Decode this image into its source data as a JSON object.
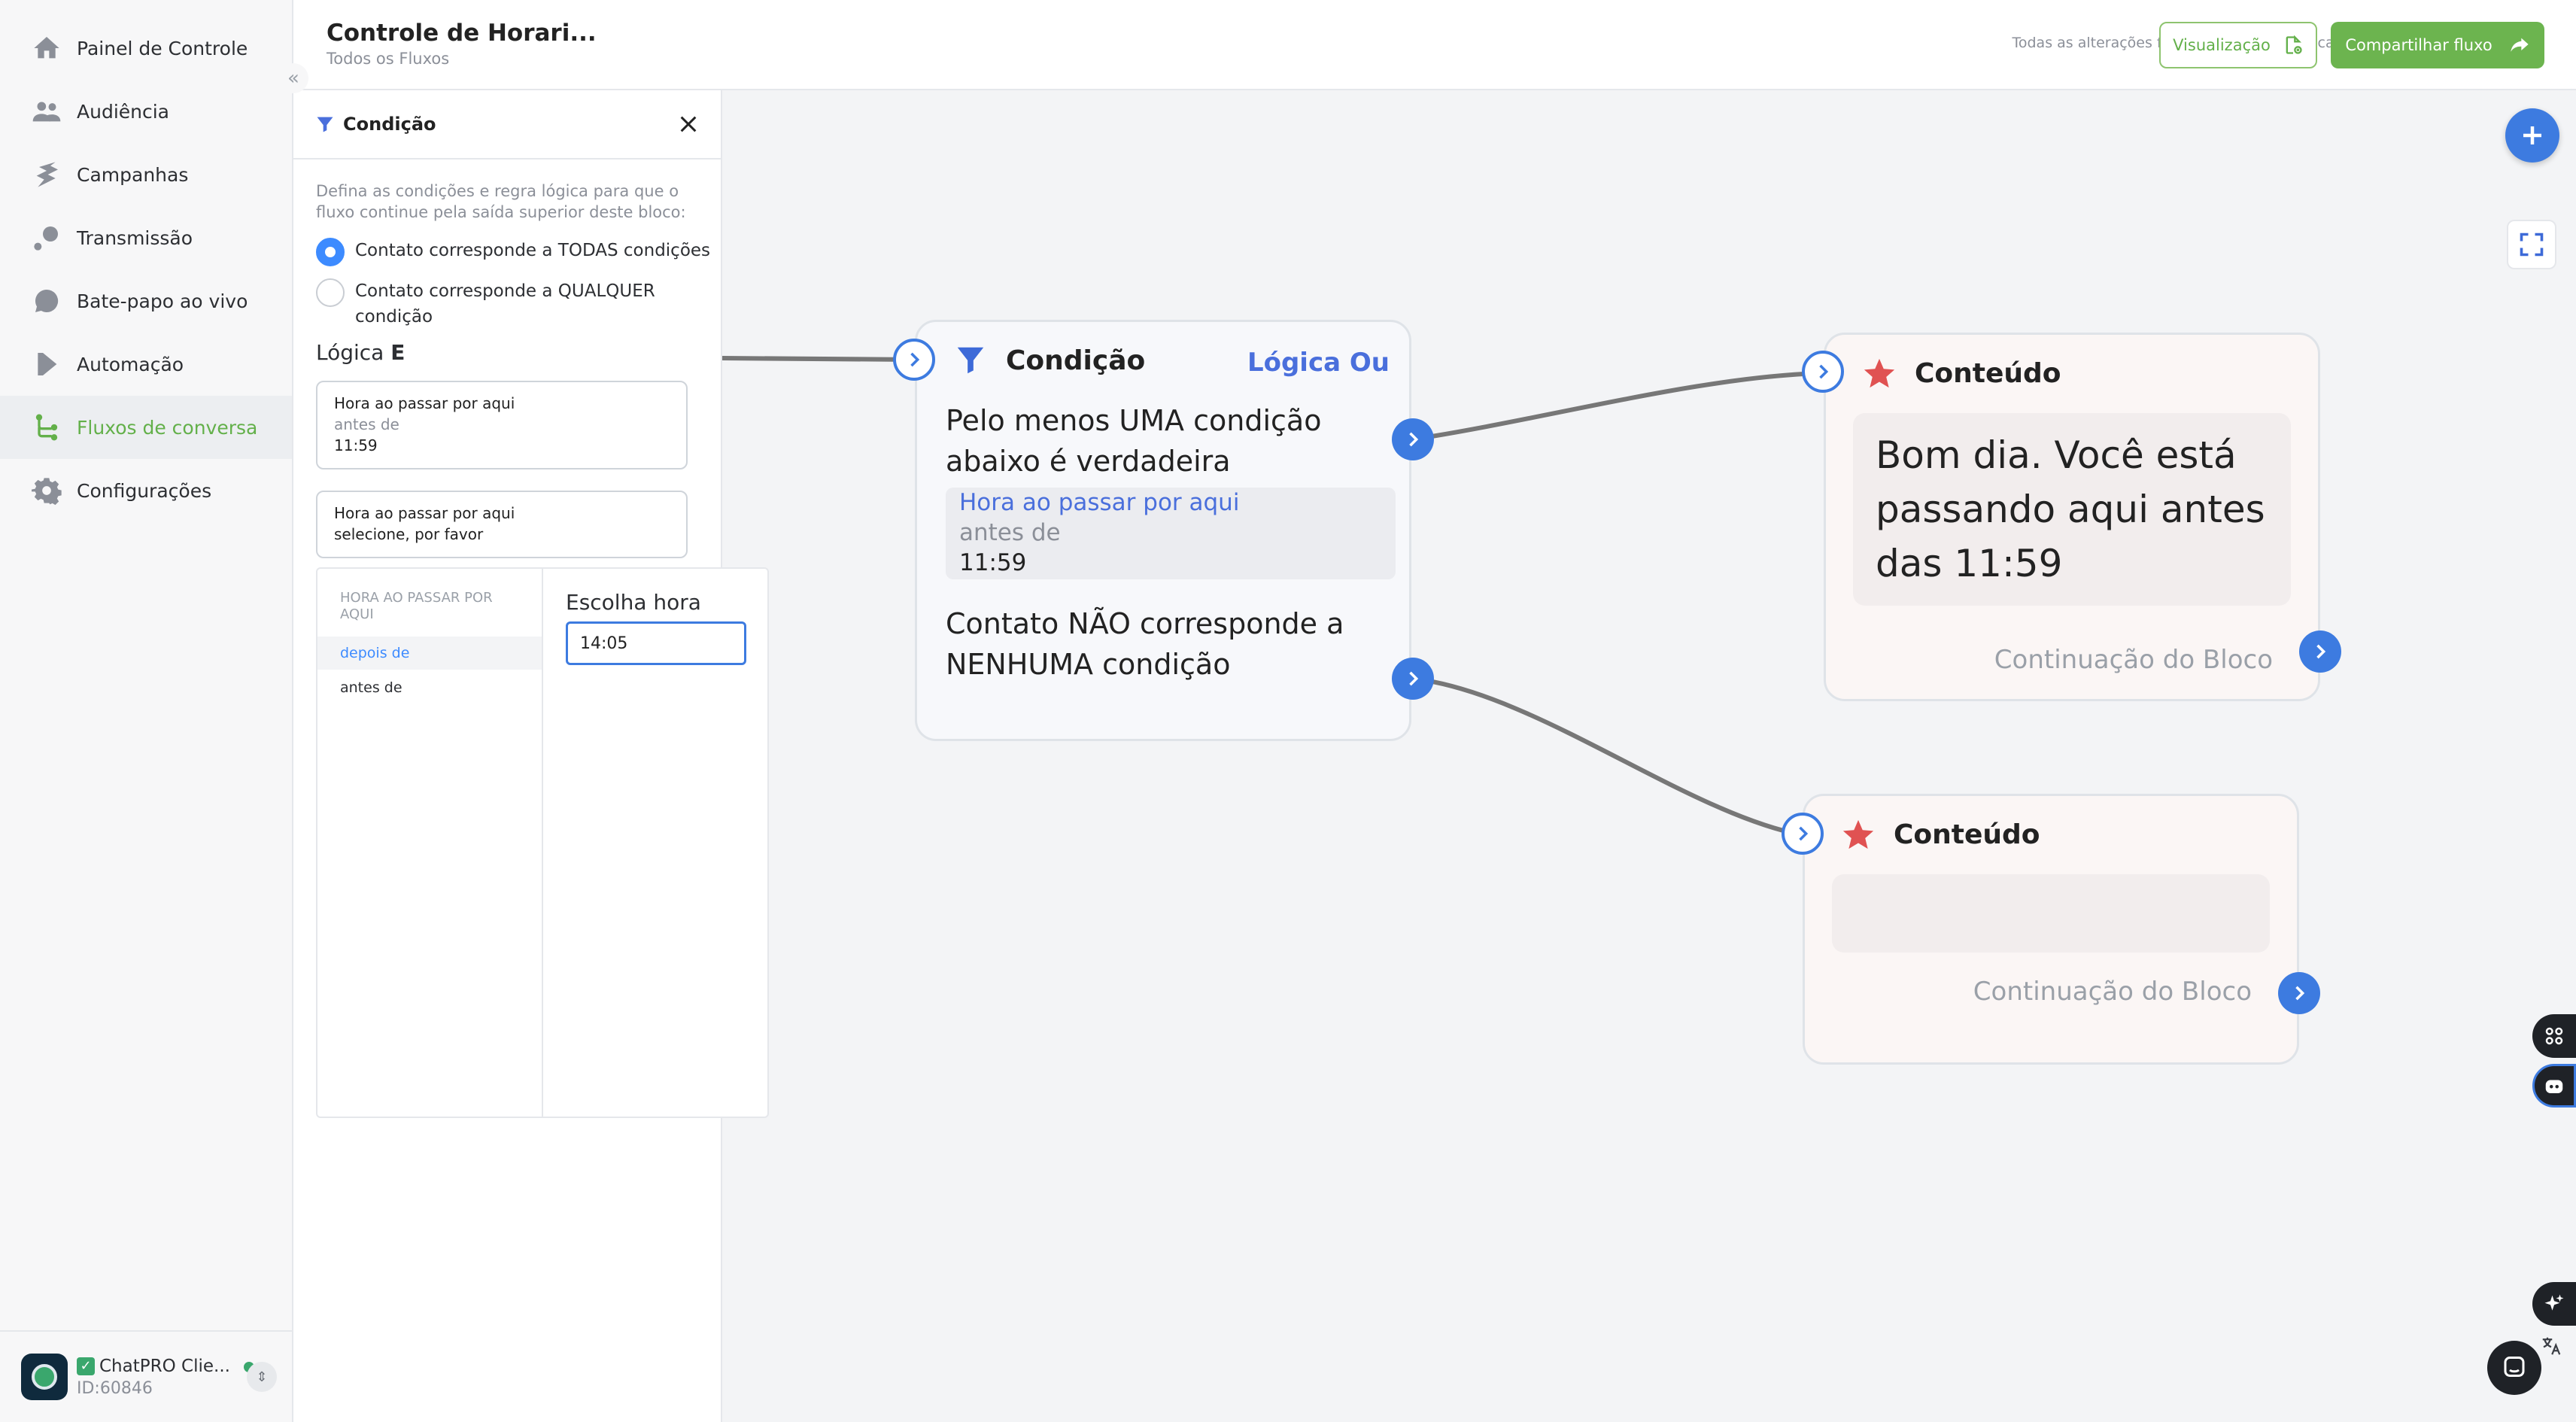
{
  "sidebar": {
    "items": [
      {
        "label": "Painel de Controle",
        "icon": "home-icon"
      },
      {
        "label": "Audiência",
        "icon": "users-icon"
      },
      {
        "label": "Campanhas",
        "icon": "bolt-icon"
      },
      {
        "label": "Transmissão",
        "icon": "broadcast-icon"
      },
      {
        "label": "Bate-papo ao vivo",
        "icon": "chat-bubble-icon"
      },
      {
        "label": "Automação",
        "icon": "play-icon"
      },
      {
        "label": "Fluxos de conversa",
        "icon": "flow-icon",
        "active": true
      },
      {
        "label": "Configurações",
        "icon": "gear-icon"
      }
    ],
    "account": {
      "name": "ChatPRO Clie...",
      "id": "ID:60846",
      "status": "online"
    }
  },
  "header": {
    "title": "Controle de Horari...",
    "breadcrumb": "Todos os Fluxos",
    "save_status": "Todas as alterações foram salvas automaticamente",
    "preview_label": "Visualização",
    "share_label": "Compartilhar fluxo"
  },
  "panel": {
    "title": "Condição",
    "description": "Defina as condições e regra lógica para que o fluxo continue pela saída superior deste bloco:",
    "radio_all": "Contato corresponde a TODAS condições",
    "radio_any": "Contato corresponde a QUALQUER condição",
    "selected_radio": "all",
    "logic_prefix": "Lógica",
    "logic_value": "E",
    "conditions": [
      {
        "field": "Hora ao passar por aqui",
        "operator": "antes de",
        "value": "11:59"
      },
      {
        "field": "Hora ao passar por aqui",
        "value": "selecione, por favor"
      }
    ],
    "picker": {
      "heading": "HORA AO PASSAR POR AQUI",
      "options": [
        "depois de",
        "antes de"
      ],
      "selected": "depois de",
      "time_label": "Escolha hora",
      "time_value": "14:05"
    }
  },
  "canvas": {
    "condition_node": {
      "title": "Condição",
      "logic": "Lógica Ou",
      "true_text": "Pelo menos UMA condição abaixo é verdadeira",
      "condition": {
        "field": "Hora ao passar por aqui",
        "operator": "antes de",
        "value": "11:59"
      },
      "false_text": "Contato NÃO corresponde a NENHUMA condição"
    },
    "content_nodes": [
      {
        "title": "Conteúdo",
        "message": "Bom dia. Você está passando aqui antes das 11:59",
        "continuation": "Continuação do Bloco"
      },
      {
        "title": "Conteúdo",
        "message": "",
        "continuation": "Continuação do Bloco"
      }
    ]
  },
  "colors": {
    "accent_green": "#63b04a",
    "accent_blue": "#3d7be0",
    "logic_blue": "#4a6fdc",
    "star_red": "#e05252",
    "edge_gray": "#777777"
  }
}
